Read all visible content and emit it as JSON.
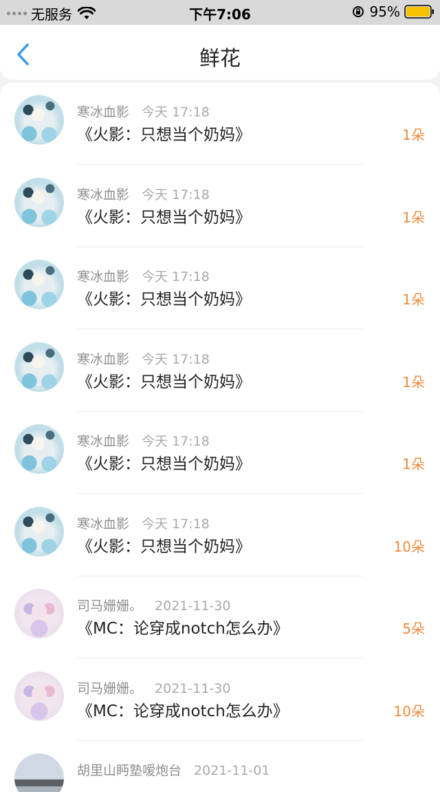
{
  "status_bar": {
    "carrier": "无服务",
    "time": "下午7:06",
    "battery": "95%"
  },
  "header": {
    "title": "鲜花"
  },
  "flowers": [
    {
      "avatar": "a",
      "name": "寒冰血影",
      "time": "今天 17:18",
      "book": "《火影：只想当个奶妈》",
      "count": "1朵"
    },
    {
      "avatar": "a",
      "name": "寒冰血影",
      "time": "今天 17:18",
      "book": "《火影：只想当个奶妈》",
      "count": "1朵"
    },
    {
      "avatar": "a",
      "name": "寒冰血影",
      "time": "今天 17:18",
      "book": "《火影：只想当个奶妈》",
      "count": "1朵"
    },
    {
      "avatar": "a",
      "name": "寒冰血影",
      "time": "今天 17:18",
      "book": "《火影：只想当个奶妈》",
      "count": "1朵"
    },
    {
      "avatar": "a",
      "name": "寒冰血影",
      "time": "今天 17:18",
      "book": "《火影：只想当个奶妈》",
      "count": "1朵"
    },
    {
      "avatar": "a",
      "name": "寒冰血影",
      "time": "今天 17:18",
      "book": "《火影：只想当个奶妈》",
      "count": "10朵"
    },
    {
      "avatar": "b",
      "name": "司马姗姗。",
      "time": "2021-11-30",
      "book": "《MC：论穿成notch怎么办》",
      "count": "5朵"
    },
    {
      "avatar": "b",
      "name": "司马姗姗。",
      "time": "2021-11-30",
      "book": "《MC：论穿成notch怎么办》",
      "count": "10朵"
    },
    {
      "avatar": "c",
      "name": "胡里山眄塾嗳炮台",
      "time": "2021-11-01",
      "book": "",
      "count": ""
    }
  ],
  "colors": {
    "accent_blue": "#3a9be8",
    "count_orange": "#f08a3c"
  }
}
